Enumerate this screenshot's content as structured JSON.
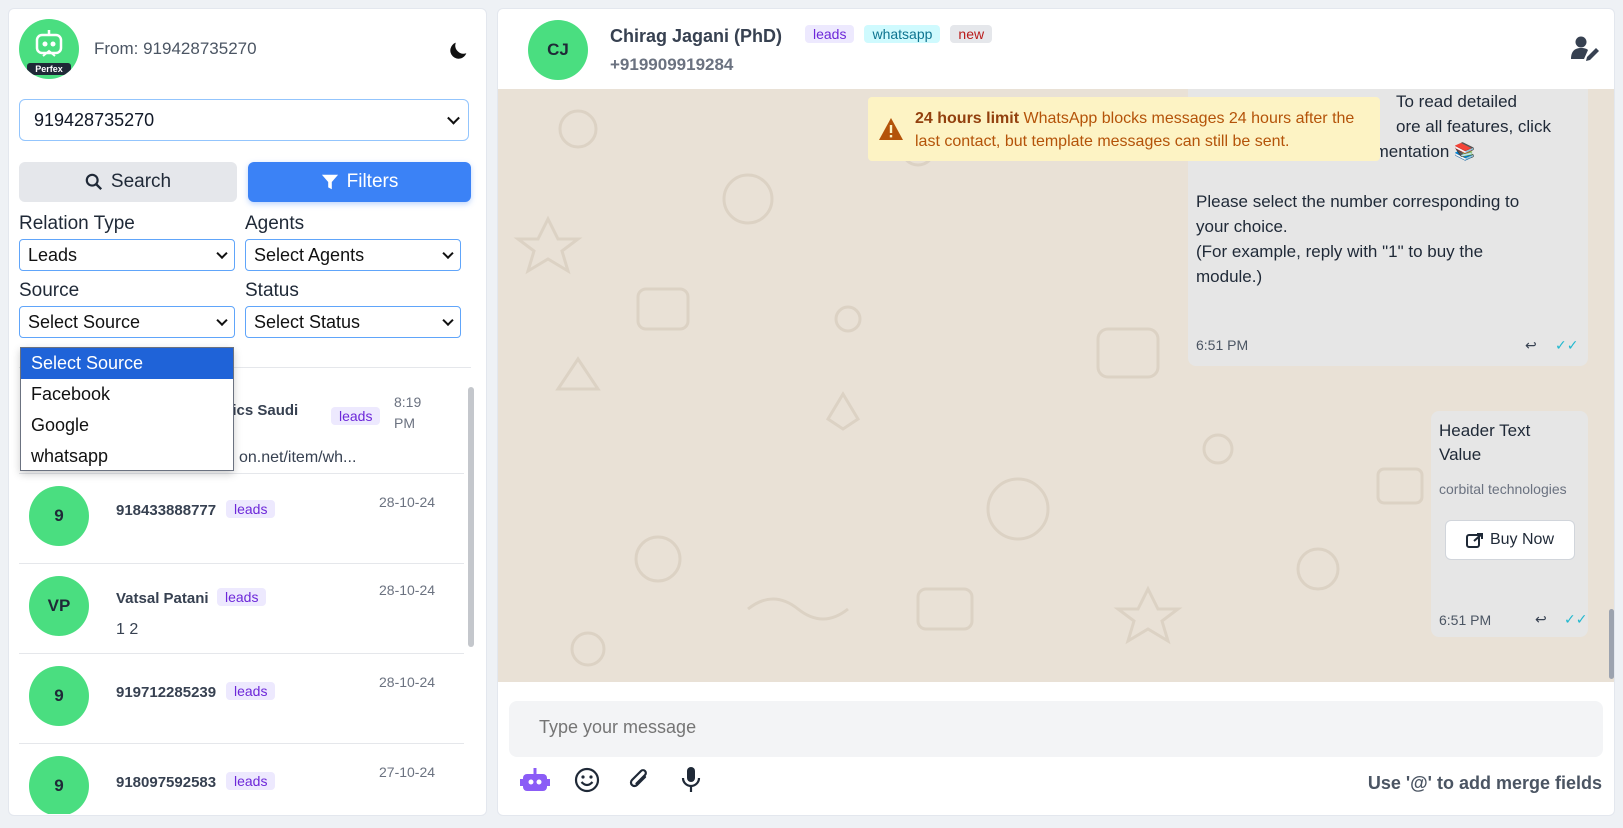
{
  "sidebar": {
    "brand": "Perfex",
    "from_label": "From: 919428735270",
    "number_select": "919428735270",
    "search_button": "Search",
    "filters_button": "Filters",
    "filters": {
      "relation_type": {
        "label": "Relation Type",
        "value": "Leads"
      },
      "agents": {
        "label": "Agents",
        "value": "Select Agents"
      },
      "source": {
        "label": "Source",
        "value": "Select Source",
        "options": [
          "Select Source",
          "Facebook",
          "Google",
          "whatsapp"
        ]
      },
      "status": {
        "label": "Status",
        "value": "Select Status"
      }
    },
    "contacts": [
      {
        "avatar": "",
        "name": "stics Saudi",
        "tag": "leads",
        "time": "8:19 PM",
        "message": "on.net/item/wh..."
      },
      {
        "avatar": "9",
        "name": "918433888777",
        "tag": "leads",
        "time": "28-10-24",
        "message": ""
      },
      {
        "avatar": "VP",
        "name": "Vatsal Patani",
        "tag": "leads",
        "time": "28-10-24",
        "message": "1 2"
      },
      {
        "avatar": "9",
        "name": "919712285239",
        "tag": "leads",
        "time": "28-10-24",
        "message": ""
      },
      {
        "avatar": "9",
        "name": "918097592583",
        "tag": "leads",
        "time": "27-10-24",
        "message": ""
      }
    ]
  },
  "chat": {
    "header": {
      "avatar": "CJ",
      "name": "Chirag Jagani (PhD)",
      "phone": "+919909919284",
      "tags": [
        "leads",
        "whatsapp",
        "new"
      ]
    },
    "alert": {
      "title": "24 hours limit",
      "text": "WhatsApp blocks messages 24 hours after the last contact, but template messages can still be sent."
    },
    "messages": [
      {
        "lines": [
          "To read detailed",
          "ore all features, click",
          "here for the online documentation 📚",
          "",
          "Please select the number corresponding to",
          "your choice.",
          "(For example, reply with \"1\" to buy the",
          "module.)"
        ],
        "time": "6:51 PM"
      },
      {
        "header": "Header Text",
        "value": "Value",
        "footer": "corbital technologies",
        "button": "Buy Now",
        "time": "6:51 PM"
      }
    ],
    "composer": {
      "placeholder": "Type your message",
      "merge_hint": "Use '@' to add merge fields"
    }
  },
  "colors": {
    "primary": "#3b82f6",
    "avatar_green": "#4ade80",
    "chat_bg": "#e9e1d6",
    "alert_bg": "#fdf3c4"
  }
}
